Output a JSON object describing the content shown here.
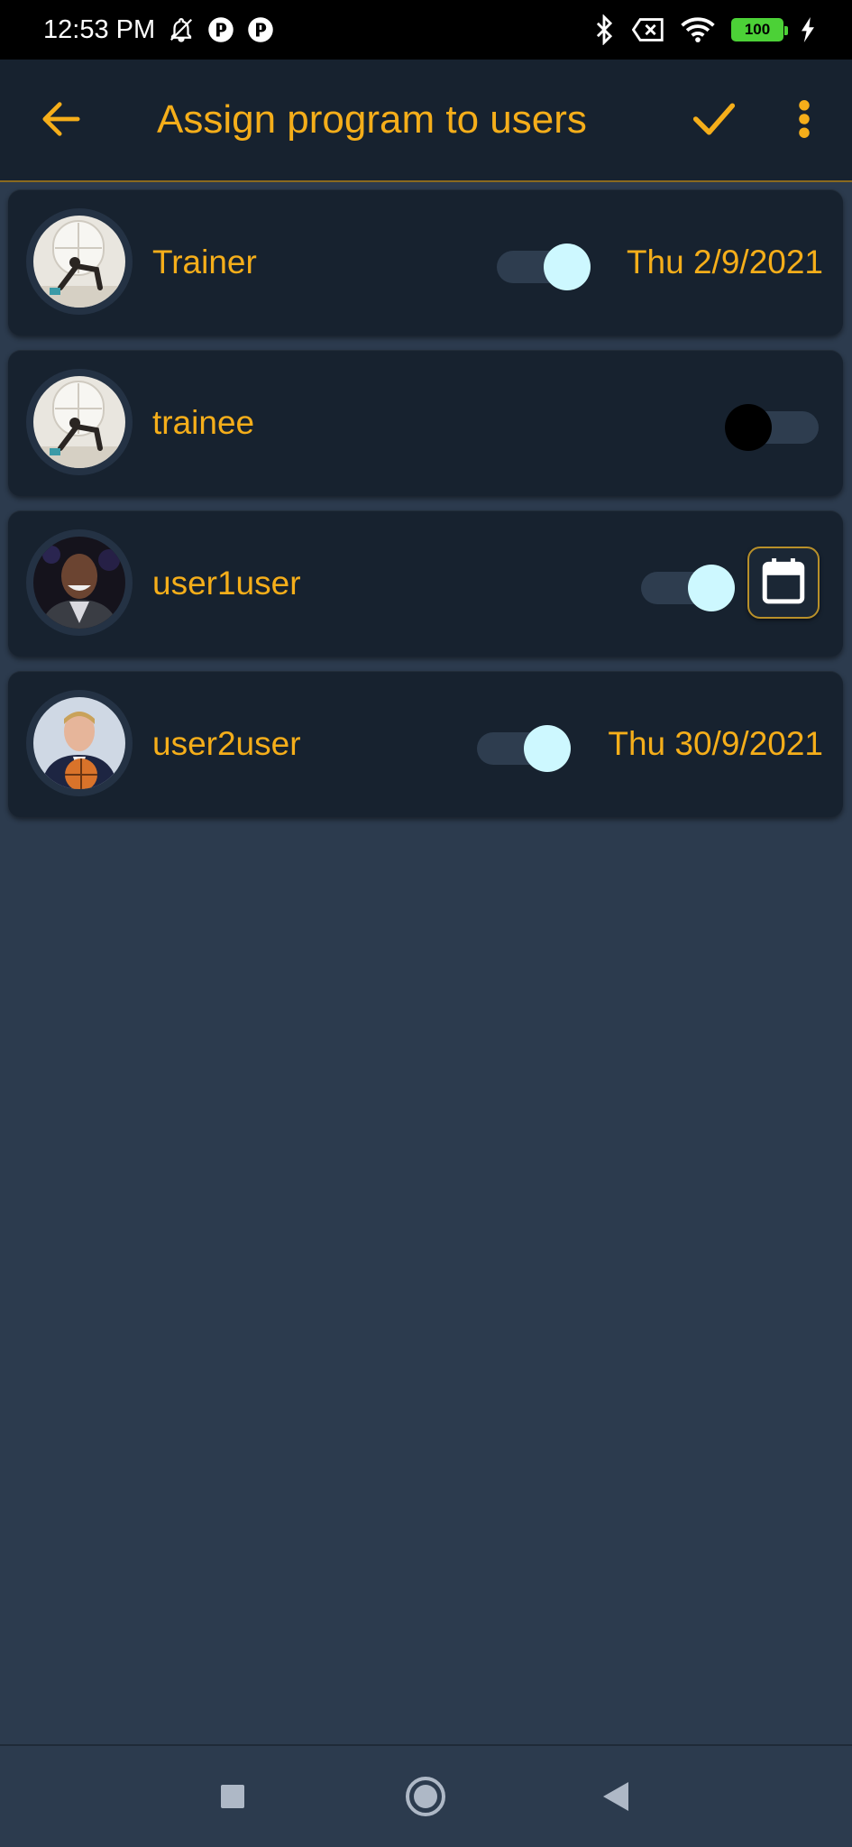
{
  "status_bar": {
    "time": "12:53 PM",
    "battery": "100",
    "icons_left": [
      "bell-off-icon",
      "app-icon",
      "app-icon"
    ],
    "icons_right": [
      "bluetooth-icon",
      "sim-off-icon",
      "wifi-icon",
      "battery-icon",
      "charging-icon"
    ]
  },
  "app_bar": {
    "title": "Assign program to users",
    "back_icon": "arrow-back-icon",
    "confirm_icon": "check-icon",
    "more_icon": "more-vert-icon"
  },
  "users": [
    {
      "name": "Trainer",
      "assigned": true,
      "date": "Thu 2/9/2021",
      "avatar": "workout-photo"
    },
    {
      "name": "trainee",
      "assigned": false,
      "date": "",
      "avatar": "workout-photo"
    },
    {
      "name": "user1user",
      "assigned": true,
      "date": "",
      "avatar": "portrait-photo",
      "action_icon": "calendar-icon"
    },
    {
      "name": "user2user",
      "assigned": true,
      "date": "Thu 30/9/2021",
      "avatar": "basketball-portrait-photo"
    }
  ],
  "nav_bar": {
    "buttons": [
      "recents-square-icon",
      "home-circle-icon",
      "back-triangle-icon"
    ]
  },
  "colors": {
    "accent": "#f5ae1a",
    "background": "#2c3b4e",
    "card": "#17222f",
    "toggle_on_thumb": "#cdf8ff",
    "toggle_off_thumb": "#000000"
  }
}
